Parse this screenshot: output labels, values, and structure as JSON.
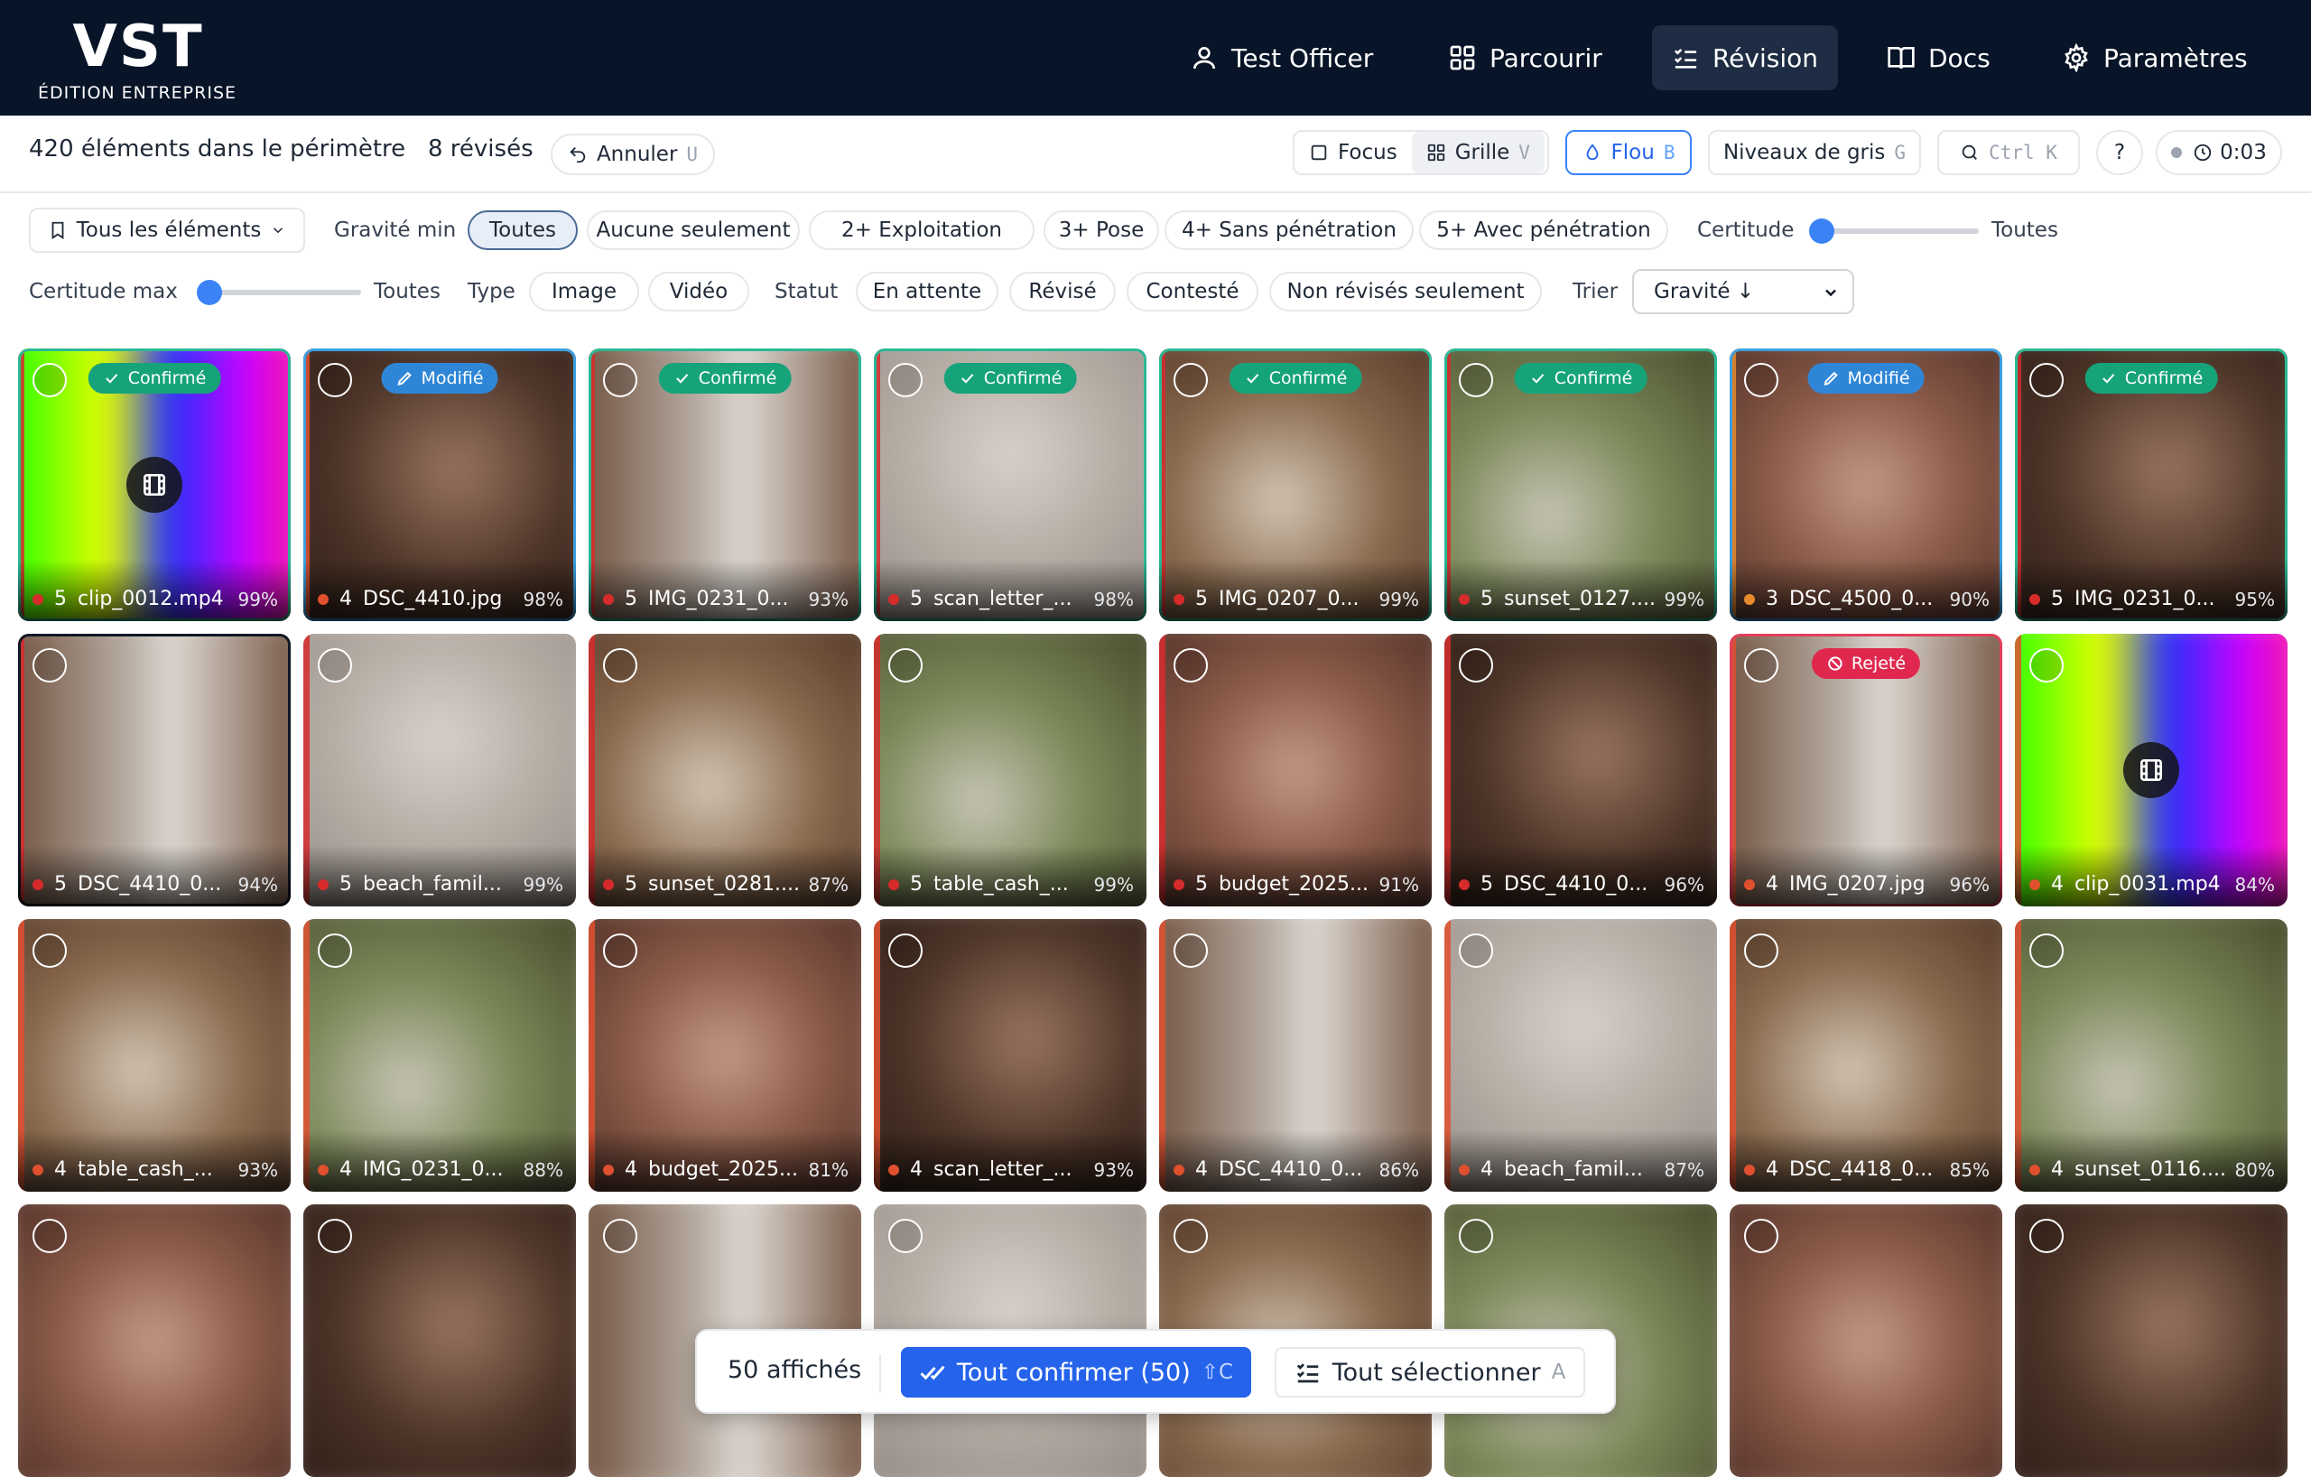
{
  "app": {
    "logo": "VST",
    "edition": "ÉDITION ENTREPRISE"
  },
  "nav": {
    "items": [
      {
        "label": "Test Officer",
        "icon": "user-icon"
      },
      {
        "label": "Parcourir",
        "icon": "grid-icon"
      },
      {
        "label": "Révision",
        "icon": "checklist-icon",
        "active": true
      },
      {
        "label": "Docs",
        "icon": "book-icon"
      },
      {
        "label": "Paramètres",
        "icon": "gear-icon"
      }
    ]
  },
  "toolbar": {
    "scope_count": "420 éléments dans le périmètre",
    "reviewed_count": "8 révisés",
    "undo_label": "Annuler",
    "undo_key": "U",
    "focus_label": "Focus",
    "grid_label": "Grille",
    "grid_key": "V",
    "blur_label": "Flou",
    "blur_key": "B",
    "gray_label": "Niveaux de gris",
    "gray_key": "G",
    "search_key": "Ctrl K",
    "help_label": "?",
    "timer": "0:03"
  },
  "filters": {
    "scope_dropdown": "Tous les éléments",
    "gravity_label": "Gravité min",
    "gravity_chips": [
      "Toutes",
      "Aucune seulement",
      "2+ Exploitation",
      "3+ Pose",
      "4+ Sans pénétration",
      "5+ Avec pénétration"
    ],
    "gravity_active": "Toutes",
    "certainty_label": "Certitude",
    "certainty_value": "Toutes",
    "certainty_min": 0,
    "certainty_max_label": "Certitude max",
    "certainty_max_value": "Toutes",
    "type_label": "Type",
    "type_chips": [
      "Image",
      "Vidéo"
    ],
    "status_label": "Statut",
    "status_chips": [
      "En attente",
      "Révisé",
      "Contesté",
      "Non révisés seulement"
    ],
    "sort_label": "Trier",
    "sort_value": "Gravité ↓"
  },
  "colors": {
    "nav_bg": "#081427",
    "accent": "#2563eb",
    "confirmed": "#17a37a",
    "modified": "#2f86d6",
    "rejected": "#e0284f",
    "sev5": "#d62b2b",
    "sev4": "#e0502f",
    "sev3": "#e8892c"
  },
  "grid": {
    "items": [
      {
        "severity": "5",
        "name": "clip_0012.mp4",
        "certainty": "99%",
        "status": "Confirmé",
        "kind": "video"
      },
      {
        "severity": "4",
        "name": "DSC_4410.jpg",
        "certainty": "98%",
        "status": "Modifié",
        "kind": "image"
      },
      {
        "severity": "5",
        "name": "IMG_0231_0...",
        "certainty": "93%",
        "status": "Confirmé",
        "kind": "image"
      },
      {
        "severity": "5",
        "name": "scan_letter_...",
        "certainty": "98%",
        "status": "Confirmé",
        "kind": "image"
      },
      {
        "severity": "5",
        "name": "IMG_0207_0...",
        "certainty": "99%",
        "status": "Confirmé",
        "kind": "image"
      },
      {
        "severity": "5",
        "name": "sunset_0127....",
        "certainty": "99%",
        "status": "Confirmé",
        "kind": "image"
      },
      {
        "severity": "3",
        "name": "DSC_4500_0...",
        "certainty": "90%",
        "status": "Modifié",
        "kind": "image"
      },
      {
        "severity": "5",
        "name": "IMG_0231_0...",
        "certainty": "95%",
        "status": "Confirmé",
        "kind": "image"
      },
      {
        "severity": "5",
        "name": "DSC_4410_0...",
        "certainty": "94%",
        "status": "",
        "kind": "image"
      },
      {
        "severity": "5",
        "name": "beach_famil...",
        "certainty": "99%",
        "status": "",
        "kind": "image"
      },
      {
        "severity": "5",
        "name": "sunset_0281....",
        "certainty": "87%",
        "status": "",
        "kind": "image"
      },
      {
        "severity": "5",
        "name": "table_cash_...",
        "certainty": "99%",
        "status": "",
        "kind": "image"
      },
      {
        "severity": "5",
        "name": "budget_2025...",
        "certainty": "91%",
        "status": "",
        "kind": "image"
      },
      {
        "severity": "5",
        "name": "DSC_4410_0...",
        "certainty": "96%",
        "status": "",
        "kind": "image"
      },
      {
        "severity": "4",
        "name": "IMG_0207.jpg",
        "certainty": "96%",
        "status": "Rejeté",
        "kind": "image"
      },
      {
        "severity": "4",
        "name": "clip_0031.mp4",
        "certainty": "84%",
        "status": "",
        "kind": "video"
      },
      {
        "severity": "4",
        "name": "table_cash_...",
        "certainty": "93%",
        "status": "",
        "kind": "image"
      },
      {
        "severity": "4",
        "name": "IMG_0231_0...",
        "certainty": "88%",
        "status": "",
        "kind": "image"
      },
      {
        "severity": "4",
        "name": "budget_2025...",
        "certainty": "81%",
        "status": "",
        "kind": "image"
      },
      {
        "severity": "4",
        "name": "scan_letter_...",
        "certainty": "93%",
        "status": "",
        "kind": "image"
      },
      {
        "severity": "4",
        "name": "DSC_4410_0...",
        "certainty": "86%",
        "status": "",
        "kind": "image"
      },
      {
        "severity": "4",
        "name": "beach_famil...",
        "certainty": "87%",
        "status": "",
        "kind": "image"
      },
      {
        "severity": "4",
        "name": "DSC_4418_0...",
        "certainty": "85%",
        "status": "",
        "kind": "image"
      },
      {
        "severity": "4",
        "name": "sunset_0116....",
        "certainty": "80%",
        "status": "",
        "kind": "image"
      },
      {
        "severity": "",
        "name": "",
        "certainty": "",
        "status": "",
        "kind": "image"
      },
      {
        "severity": "",
        "name": "",
        "certainty": "",
        "status": "",
        "kind": "image"
      },
      {
        "severity": "",
        "name": "",
        "certainty": "",
        "status": "",
        "kind": "image"
      },
      {
        "severity": "",
        "name": "",
        "certainty": "",
        "status": "",
        "kind": "image"
      },
      {
        "severity": "",
        "name": "",
        "certainty": "",
        "status": "",
        "kind": "image"
      },
      {
        "severity": "",
        "name": "",
        "certainty": "",
        "status": "",
        "kind": "image"
      },
      {
        "severity": "",
        "name": "",
        "certainty": "",
        "status": "",
        "kind": "image"
      },
      {
        "severity": "",
        "name": "",
        "certainty": "",
        "status": "",
        "kind": "image"
      }
    ]
  },
  "bottombar": {
    "shown_count": "50 affichés",
    "confirm_all": "Tout confirmer (50)",
    "confirm_key": "⇧C",
    "select_all": "Tout sélectionner",
    "select_key": "A"
  }
}
